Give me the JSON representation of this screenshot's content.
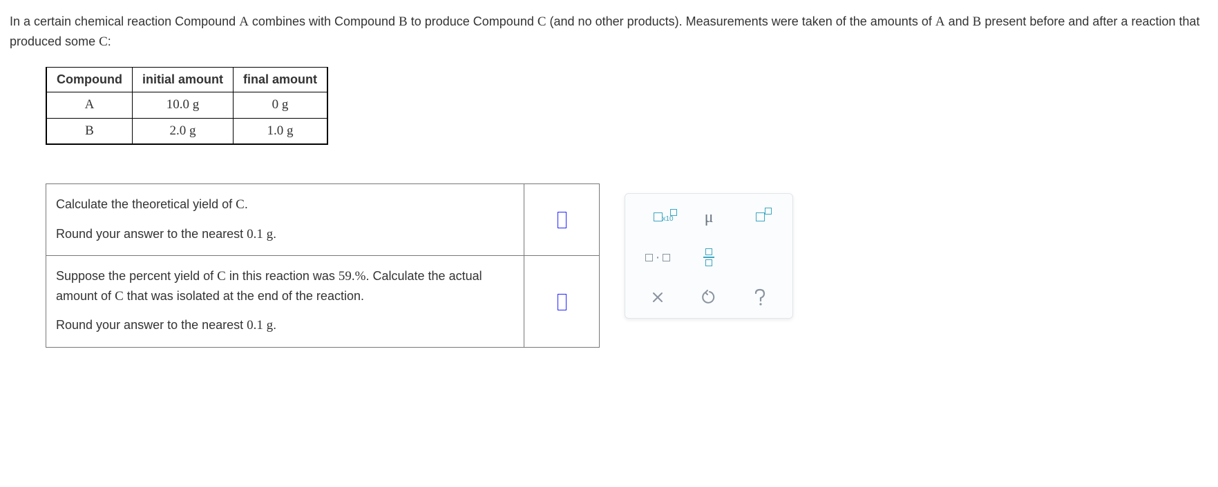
{
  "intro": {
    "part1": "In a certain chemical reaction Compound ",
    "A": "A",
    "part2": " combines with Compound ",
    "B": "B",
    "part3": " to produce Compound ",
    "C": "C",
    "part4": " (and no other products). Measurements were taken of the amounts of ",
    "A2": "A",
    "part5": " and ",
    "B2": "B",
    "part6": " present before and after a reaction that produced some ",
    "C2": "C",
    "part7": ":"
  },
  "table": {
    "headers": [
      "Compound",
      "initial amount",
      "final amount"
    ],
    "rows": [
      {
        "compound": "A",
        "initial": "10.0 g",
        "final": "0 g"
      },
      {
        "compound": "B",
        "initial": "2.0 g",
        "final": "1.0 g"
      }
    ]
  },
  "q1": {
    "line1a": "Calculate the theoretical yield of ",
    "line1b": "C",
    "line1c": ".",
    "line2a": "Round your answer to the nearest ",
    "line2b": "0.1 g",
    "line2c": "."
  },
  "q2": {
    "line1a": "Suppose the percent yield of ",
    "line1b": "C",
    "line1c": " in this reaction was ",
    "line1d": "59.%",
    "line1e": ". Calculate the actual amount of ",
    "line1f": "C",
    "line1g": " that was isolated at the end of the reaction.",
    "line2a": "Round your answer to the nearest ",
    "line2b": "0.1 g",
    "line2c": "."
  },
  "palette": {
    "sci_sub": "x10",
    "mu": "μ",
    "dot": "·"
  }
}
